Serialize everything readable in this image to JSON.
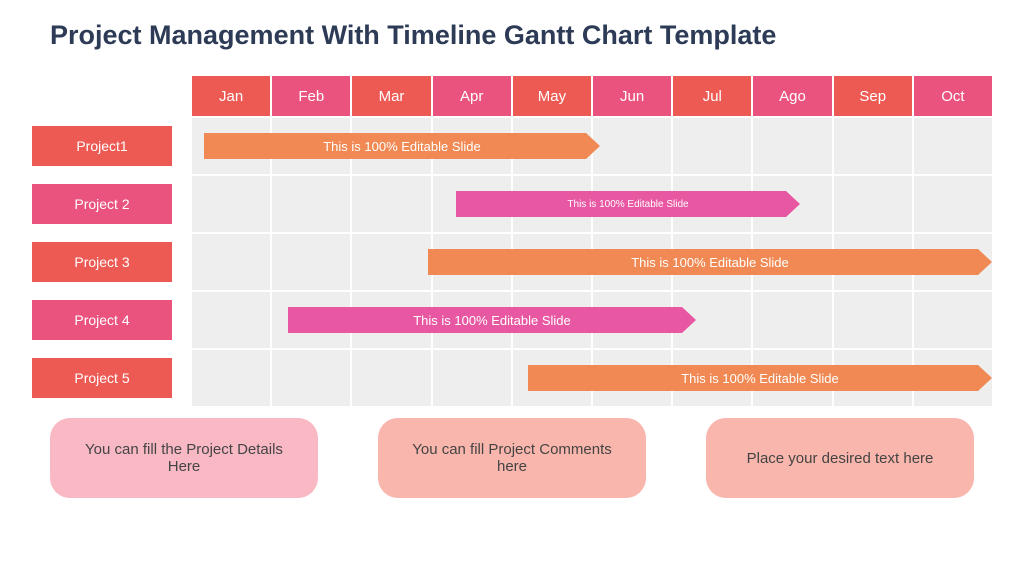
{
  "title": "Project Management With Timeline Gantt Chart Template",
  "colors": {
    "coral": "#ed5a53",
    "pink": "#e9537e",
    "orange": "#f08953",
    "magenta": "#e857a2",
    "lightpink": "#f8b9c5",
    "salmon": "#f9b6ac"
  },
  "chart_data": {
    "type": "bar",
    "title": "Project Management With Timeline Gantt Chart Template",
    "categories": [
      "Jan",
      "Feb",
      "Mar",
      "Apr",
      "May",
      "Jun",
      "Jul",
      "Ago",
      "Sep",
      "Oct"
    ],
    "month_colors": [
      "coral",
      "pink",
      "coral",
      "pink",
      "coral",
      "pink",
      "coral",
      "pink",
      "coral",
      "pink"
    ],
    "series": [
      {
        "name": "Project1",
        "label_color": "coral",
        "start": 0.15,
        "end": 5.1,
        "bar_color": "orange",
        "text": "This is 100% Editable Slide"
      },
      {
        "name": "Project 2",
        "label_color": "pink",
        "start": 3.3,
        "end": 7.6,
        "bar_color": "magenta",
        "text": "This is 100% Editable Slide",
        "small": true
      },
      {
        "name": "Project 3",
        "label_color": "coral",
        "start": 2.95,
        "end": 10.0,
        "bar_color": "orange",
        "text": "This is 100% Editable Slide"
      },
      {
        "name": "Project 4",
        "label_color": "pink",
        "start": 1.2,
        "end": 6.3,
        "bar_color": "magenta",
        "text": "This is 100% Editable Slide"
      },
      {
        "name": "Project 5",
        "label_color": "coral",
        "start": 4.2,
        "end": 10.0,
        "bar_color": "orange",
        "text": "This is 100% Editable Slide"
      }
    ]
  },
  "footer": [
    {
      "text": "You can fill the Project Details Here",
      "color": "lightpink"
    },
    {
      "text": "You can fill Project Comments here",
      "color": "salmon"
    },
    {
      "text": "Place your desired text here",
      "color": "salmon"
    }
  ]
}
